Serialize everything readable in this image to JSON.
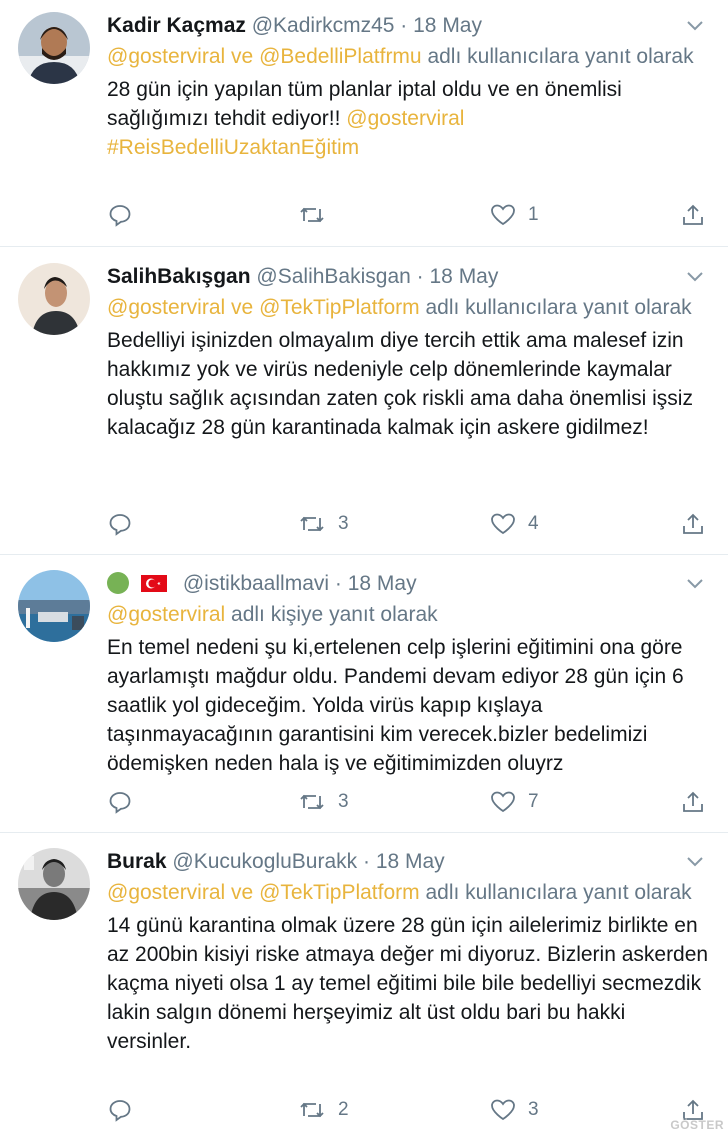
{
  "tweets": [
    {
      "name": "Kadir Kaçmaz",
      "handle": "@Kadirkcmz45",
      "dot": "·",
      "date": "18 May",
      "reply_mentions": [
        "@gosterviral",
        "ve",
        "@BedelliPlatfrmu"
      ],
      "reply_suffix": "adlı kullanıcılara yanıt olarak",
      "text": "28 gün için yapılan tüm planlar iptal oldu ve en önemlisi sağlığımızı tehdit ediyor!! ",
      "text_mentions": [
        "@gosterviral",
        "#ReisBedelliUzaktanEğitim"
      ],
      "replies": "",
      "retweets": "",
      "likes": "1"
    },
    {
      "name": "SalihBakışgan",
      "handle": "@SalihBakisgan",
      "dot": "·",
      "date": "18 May",
      "reply_mentions": [
        "@gosterviral",
        "ve",
        "@TekTipPlatform"
      ],
      "reply_suffix": "adlı kullanıcılara yanıt olarak",
      "text": "Bedelliyi işinizden olmayalım diye tercih ettik ama malesef izin hakkımız yok ve virüs nedeniyle celp dönemlerinde kaymalar oluştu sağlık açısından zaten çok riskli ama daha önemlisi işsiz kalacağız 28 gün karantinada kalmak için askere gidilmez!",
      "replies": "",
      "retweets": "3",
      "likes": "4"
    },
    {
      "name": "",
      "handle": "@istikbaallmavi",
      "dot": "·",
      "date": "18 May",
      "reply_mentions": [
        "@gosterviral"
      ],
      "reply_suffix": "adlı kişiye yanıt olarak",
      "text": "En temel nedeni şu ki,ertelenen celp işlerini eğitimini ona göre ayarlamıştı mağdur oldu. Pandemi devam ediyor 28 gün için 6 saatlik yol gideceğim. Yolda virüs kapıp kışlaya taşınmayacağının garantisini kim verecek.bizler bedelimizi ödemişken neden hala iş ve eğitimimizden oluyrz",
      "replies": "",
      "retweets": "3",
      "likes": "7"
    },
    {
      "name": "Burak",
      "handle": "@KucukogluBurakk",
      "dot": "·",
      "date": "18 May",
      "reply_mentions": [
        "@gosterviral",
        "ve",
        "@TekTipPlatform"
      ],
      "reply_suffix": "adlı kullanıcılara yanıt olarak",
      "text": "14 günü karantina olmak üzere 28 gün için ailelerimiz birlikte en az 200bin kisiyi riske atmaya değer mi diyoruz. Bizlerin askerden kaçma niyeti olsa 1 ay temel eğitimi bile bile bedelliyi secmezdik lakin salgın dönemi herşeyimiz alt üst oldu bari bu hakki versinler.",
      "replies": "",
      "retweets": "2",
      "likes": "3"
    }
  ],
  "watermark": "GÖSTER",
  "colors": {
    "mention": "#e8b43d",
    "secondary": "#657786",
    "text": "#14171a",
    "divider": "#e6ecf0"
  },
  "icons": [
    "reply-icon",
    "retweet-icon",
    "like-icon",
    "share-icon",
    "caret-down-icon"
  ]
}
